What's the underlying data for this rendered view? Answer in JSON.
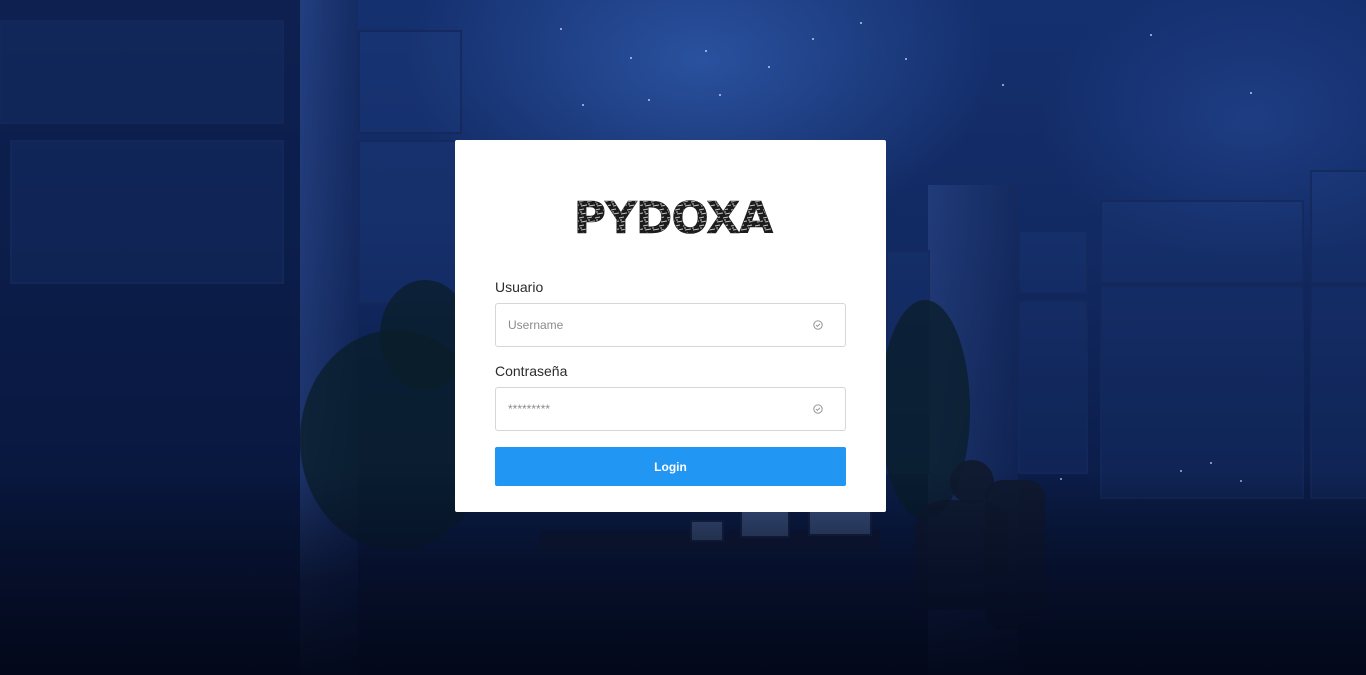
{
  "logo": {
    "text": "PYDOXA"
  },
  "form": {
    "username": {
      "label": "Usuario",
      "placeholder": "Username",
      "value": ""
    },
    "password": {
      "label": "Contraseña",
      "placeholder": "*********",
      "value": ""
    },
    "login_label": "Login"
  },
  "colors": {
    "primary_button": "#2196f3",
    "card_background": "#ffffff",
    "page_background": "#122a63"
  },
  "icons": {
    "input_status": "check-circle-icon"
  }
}
